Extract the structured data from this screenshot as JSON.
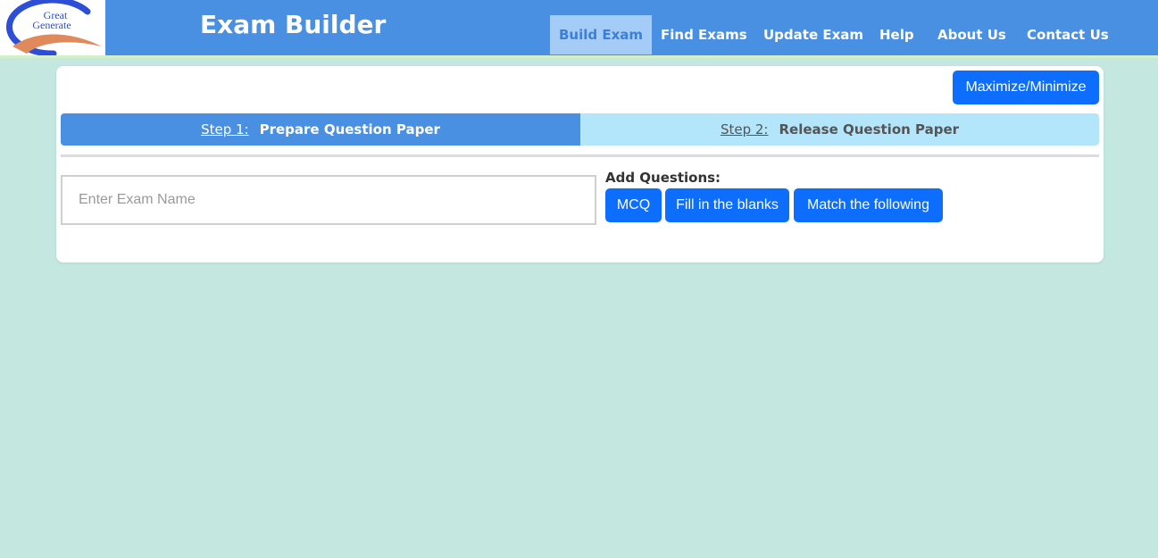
{
  "header": {
    "logo": {
      "line1": "Great",
      "line2": "Generate"
    },
    "title": "Exam Builder",
    "nav": [
      {
        "label": "Build Exam",
        "active": true
      },
      {
        "label": "Find Exams",
        "active": false
      },
      {
        "label": "Update Exam",
        "active": false
      },
      {
        "label": "Help",
        "active": false
      },
      {
        "label": "About Us",
        "active": false
      },
      {
        "label": "Contact Us",
        "active": false
      }
    ]
  },
  "card": {
    "toggle_label": "Maximize/Minimize",
    "steps": [
      {
        "number": "Step 1:",
        "label": "Prepare Question Paper",
        "active": true
      },
      {
        "number": "Step 2:",
        "label": "Release Question Paper",
        "active": false
      }
    ],
    "exam_name": {
      "value": "",
      "placeholder": "Enter Exam Name"
    },
    "add_questions": {
      "label": "Add Questions:",
      "buttons": [
        "MCQ",
        "Fill in the blanks",
        "Match the following"
      ]
    }
  },
  "colors": {
    "nav_bg": "#4a90e2",
    "nav_active_bg": "#a4ccf6",
    "page_bg": "#c4e7e0",
    "button_blue": "#0d6efd",
    "step_active_bg": "#4a90e2",
    "step_inactive_bg": "#b3e5fb",
    "logo_blue": "#2c4fd6",
    "logo_orange": "#e08a5c"
  }
}
